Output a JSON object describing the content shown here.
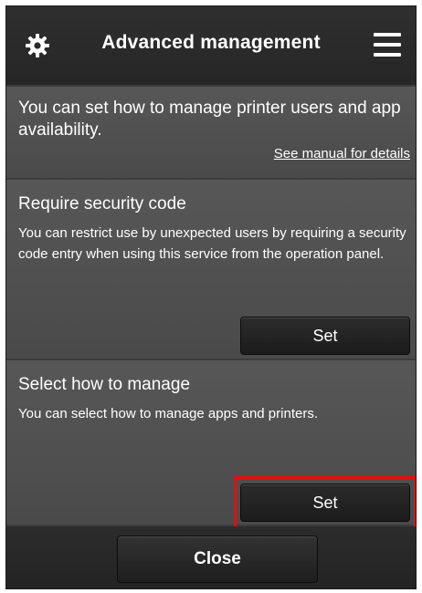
{
  "header": {
    "title": "Advanced management",
    "left_icon": "gear-icon",
    "right_icon": "hamburger-menu-icon"
  },
  "intro": {
    "text": "You can set how to manage printer users and app availability.",
    "link": "See manual for details"
  },
  "security_section": {
    "title": "Require security code",
    "description": "You can restrict use by unexpected users by requiring a security code entry when using this service from the operation panel.",
    "button_label": "Set"
  },
  "manage_section": {
    "title": "Select how to manage",
    "description": "You can select how to manage apps and printers.",
    "button_label": "Set",
    "highlight_color": "#e01010"
  },
  "footer": {
    "close_label": "Close"
  }
}
